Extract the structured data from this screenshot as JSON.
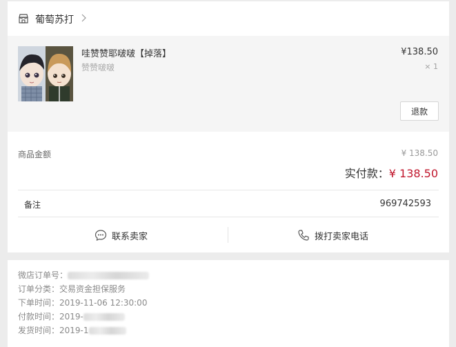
{
  "shop": {
    "name": "葡萄苏打",
    "icon": "store-icon",
    "chevron": "chevron-right-icon"
  },
  "product": {
    "title": "哇赞赞耶啵啵【掉落】",
    "variant": "赞赞啵啵",
    "price": "¥138.50",
    "quantity": "× 1",
    "refund_label": "退款"
  },
  "summary": {
    "goods_amount_label": "商品金额",
    "goods_amount_value": "¥ 138.50",
    "paid_label": "实付款：",
    "paid_value": "¥ 138.50",
    "note_label": "备注",
    "note_value": "969742593"
  },
  "actions": {
    "contact_seller": "联系卖家",
    "call_seller": "拨打卖家电话"
  },
  "order_info": {
    "order_no_label": "微店订单号：",
    "category_text": "订单分类：交易资金担保服务",
    "created_text": "下单时间：2019-11-06 12:30:00",
    "paid_text_prefix": "付款时间：2019-",
    "shipped_text_prefix": "发货时间：2019-1"
  },
  "colors": {
    "accent": "#c0152b",
    "page_bg": "#ececec",
    "product_bg": "#f5f5f5"
  }
}
